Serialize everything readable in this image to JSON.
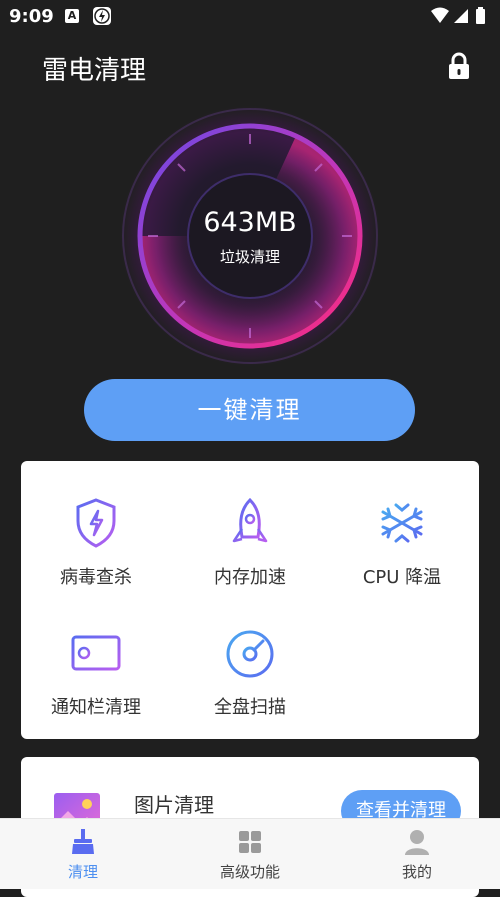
{
  "status_bar": {
    "time": "9:09",
    "notification_icon_letter": "A"
  },
  "header": {
    "title": "雷电清理"
  },
  "gauge": {
    "value": "643MB",
    "label": "垃圾清理",
    "fill_fraction": 0.72
  },
  "clean_button": {
    "label": "一键清理"
  },
  "features": [
    {
      "label": "病毒查杀",
      "icon": "shield-bolt-icon"
    },
    {
      "label": "内存加速",
      "icon": "rocket-icon"
    },
    {
      "label": "CPU 降温",
      "icon": "snowflake-icon"
    },
    {
      "label": "通知栏清理",
      "icon": "notification-card-icon"
    },
    {
      "label": "全盘扫描",
      "icon": "disk-scan-icon"
    }
  ],
  "photo_card": {
    "title": "图片清理",
    "button": "查看并清理"
  },
  "bottom_nav": [
    {
      "label": "清理",
      "icon": "broom-icon",
      "active": true
    },
    {
      "label": "高级功能",
      "icon": "grid-icon",
      "active": false
    },
    {
      "label": "我的",
      "icon": "person-icon",
      "active": false
    }
  ],
  "colors": {
    "accent": "#5e9ff5",
    "background": "#1f1f1f",
    "gauge_pink": "#e82a8c",
    "gauge_purple": "#7a45e0"
  }
}
